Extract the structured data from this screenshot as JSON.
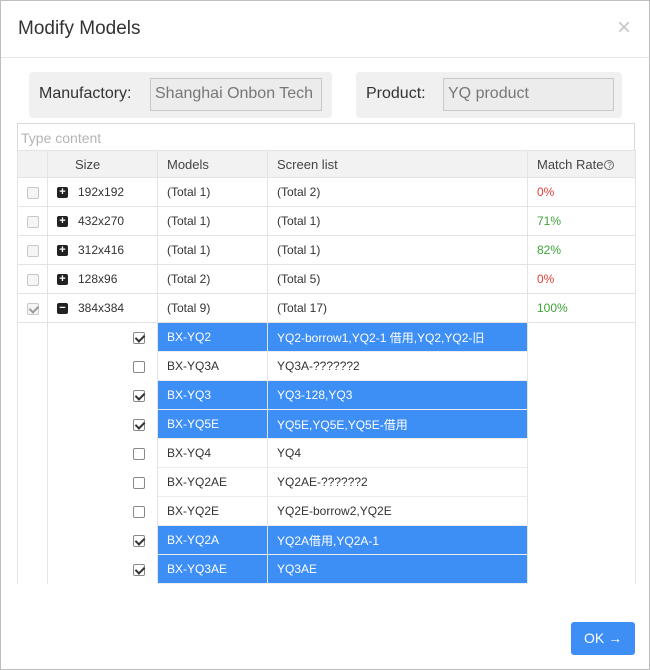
{
  "dialog": {
    "title": "Modify Models",
    "close_symbol": "×"
  },
  "manufactory": {
    "label": "Manufactory:",
    "value": "Shanghai Onbon Tech"
  },
  "product": {
    "label": "Product:",
    "value": "YQ product"
  },
  "search": {
    "placeholder": "Type content"
  },
  "table": {
    "headers": {
      "size": "Size",
      "models": "Models",
      "screen_list": "Screen list",
      "match_rate": "Match Rate"
    },
    "groups": [
      {
        "size": "192x192",
        "models": "(Total 1)",
        "screens": "(Total 2)",
        "rate": "0%",
        "expanded": false,
        "checked": false
      },
      {
        "size": "432x270",
        "models": "(Total 1)",
        "screens": "(Total 1)",
        "rate": "71%",
        "expanded": false,
        "checked": false
      },
      {
        "size": "312x416",
        "models": "(Total 1)",
        "screens": "(Total 1)",
        "rate": "82%",
        "expanded": false,
        "checked": false
      },
      {
        "size": "128x96",
        "models": "(Total 2)",
        "screens": "(Total 5)",
        "rate": "0%",
        "expanded": false,
        "checked": false
      },
      {
        "size": "384x384",
        "models": "(Total 9)",
        "screens": "(Total 17)",
        "rate": "100%",
        "expanded": true,
        "checked": true
      }
    ],
    "sub_rows": [
      {
        "model": "BX-YQ2",
        "screens": "YQ2-borrow1,YQ2-1 借用,YQ2,YQ2-旧",
        "checked": true
      },
      {
        "model": "BX-YQ3A",
        "screens": "YQ3A-??????2",
        "checked": false
      },
      {
        "model": "BX-YQ3",
        "screens": "YQ3-128,YQ3",
        "checked": true
      },
      {
        "model": "BX-YQ5E",
        "screens": "YQ5E,YQ5E,YQ5E-借用",
        "checked": true
      },
      {
        "model": "BX-YQ4",
        "screens": "YQ4",
        "checked": false
      },
      {
        "model": "BX-YQ2AE",
        "screens": "YQ2AE-??????2",
        "checked": false
      },
      {
        "model": "BX-YQ2E",
        "screens": "YQ2E-borrow2,YQ2E",
        "checked": false
      },
      {
        "model": "BX-YQ2A",
        "screens": "YQ2A借用,YQ2A-1",
        "checked": true
      },
      {
        "model": "BX-YQ3AE",
        "screens": "YQ3AE",
        "checked": true
      }
    ]
  },
  "footer": {
    "ok_label": "OK",
    "ok_icon": "arrow-right-icon"
  },
  "colors": {
    "accent": "#3d8ef5",
    "rate_zero": "#e0403a",
    "rate_positive": "#3fa33a"
  }
}
